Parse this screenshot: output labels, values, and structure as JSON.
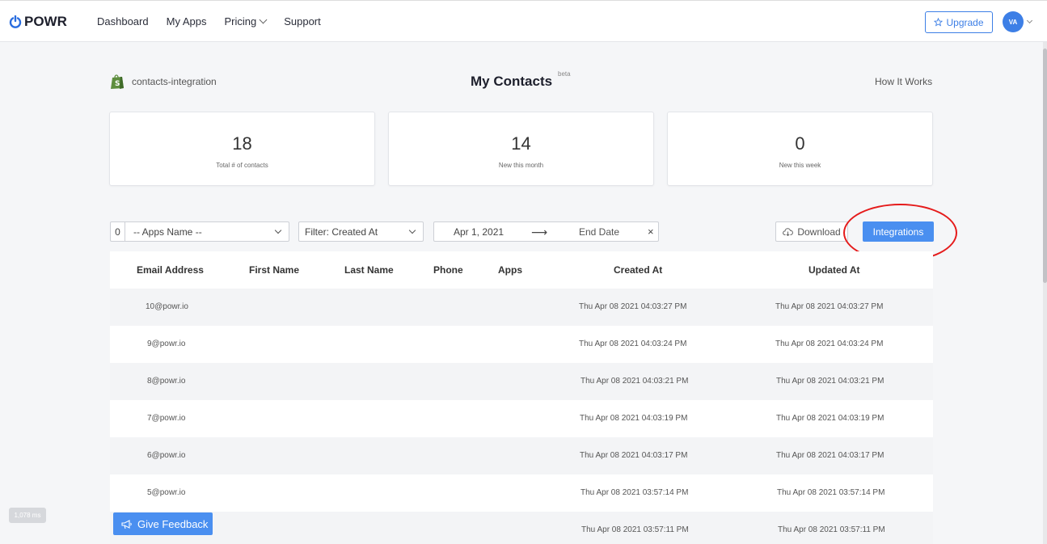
{
  "brand": {
    "name": "POWR"
  },
  "nav": {
    "dashboard": "Dashboard",
    "my_apps": "My Apps",
    "pricing": "Pricing",
    "support": "Support"
  },
  "header": {
    "upgrade": "Upgrade",
    "avatar_initials": "VA"
  },
  "page": {
    "store_name": "contacts-integration",
    "title": "My Contacts",
    "beta": "beta",
    "how_it_works": "How It Works"
  },
  "stats": [
    {
      "value": "18",
      "label": "Total # of contacts"
    },
    {
      "value": "14",
      "label": "New this month"
    },
    {
      "value": "0",
      "label": "New this week"
    }
  ],
  "filters": {
    "apps_count": "0",
    "apps_name": "-- Apps Name --",
    "filter_created": "Filter: Created At",
    "start_date": "Apr 1, 2021",
    "end_date": "End Date",
    "clear": "×",
    "download": "Download",
    "integrations": "Integrations"
  },
  "table": {
    "columns": [
      "Email Address",
      "First Name",
      "Last Name",
      "Phone",
      "Apps",
      "Created At",
      "Updated At"
    ],
    "rows": [
      {
        "email": "10@powr.io",
        "created": "Thu Apr 08 2021 04:03:27 PM",
        "updated": "Thu Apr 08 2021 04:03:27 PM"
      },
      {
        "email": "9@powr.io",
        "created": "Thu Apr 08 2021 04:03:24 PM",
        "updated": "Thu Apr 08 2021 04:03:24 PM"
      },
      {
        "email": "8@powr.io",
        "created": "Thu Apr 08 2021 04:03:21 PM",
        "updated": "Thu Apr 08 2021 04:03:21 PM"
      },
      {
        "email": "7@powr.io",
        "created": "Thu Apr 08 2021 04:03:19 PM",
        "updated": "Thu Apr 08 2021 04:03:19 PM"
      },
      {
        "email": "6@powr.io",
        "created": "Thu Apr 08 2021 04:03:17 PM",
        "updated": "Thu Apr 08 2021 04:03:17 PM"
      },
      {
        "email": "5@powr.io",
        "created": "Thu Apr 08 2021 03:57:14 PM",
        "updated": "Thu Apr 08 2021 03:57:14 PM"
      },
      {
        "email": "",
        "created": "Thu Apr 08 2021 03:57:11 PM",
        "updated": "Thu Apr 08 2021 03:57:11 PM"
      }
    ]
  },
  "feedback": {
    "label": "Give Feedback"
  },
  "debug": {
    "timer": "1,078 ms"
  },
  "colors": {
    "accent": "#4a8ff0",
    "annotation": "#e51b1b"
  },
  "icons": {
    "logo": "powr-power-icon",
    "shop": "shopify-bag-icon",
    "upgrade": "star-icon",
    "download": "cloud-download-icon",
    "feedback": "megaphone-icon"
  }
}
